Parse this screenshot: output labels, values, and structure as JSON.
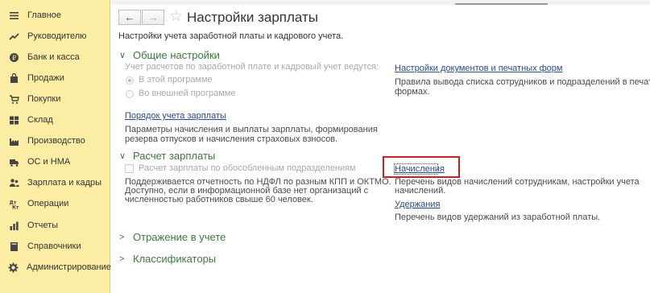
{
  "sidebar": {
    "items": [
      {
        "label": "Главное",
        "icon": "menu-icon"
      },
      {
        "label": "Руководителю",
        "icon": "trend-icon"
      },
      {
        "label": "Банк и касса",
        "icon": "coin-icon"
      },
      {
        "label": "Продажи",
        "icon": "bag-icon"
      },
      {
        "label": "Покупки",
        "icon": "cart-icon"
      },
      {
        "label": "Склад",
        "icon": "warehouse-icon"
      },
      {
        "label": "Производство",
        "icon": "factory-icon"
      },
      {
        "label": "ОС и НМА",
        "icon": "truck-icon"
      },
      {
        "label": "Зарплата и кадры",
        "icon": "people-icon"
      },
      {
        "label": "Операции",
        "icon": "dt-kt-icon"
      },
      {
        "label": "Отчеты",
        "icon": "chart-icon"
      },
      {
        "label": "Справочники",
        "icon": "book-icon"
      },
      {
        "label": "Администрирование",
        "icon": "gear-icon"
      }
    ]
  },
  "header": {
    "back": "←",
    "forward": "→",
    "title": "Настройки зарплаты",
    "subtitle": "Настройки учета заработной платы и кадрового учета."
  },
  "general": {
    "heading": "Общие настройки",
    "question": "Учет расчетов по заработной плате и кадровый учет ведутся:",
    "option_this": "В этой программе",
    "option_external": "Во внешней программе",
    "order_link": "Порядок учета зарплаты",
    "order_desc_1": "Параметры начисления и выплаты зарплаты, формирования",
    "order_desc_2": "резерва отпусков и начисления страховых взносов.",
    "docs_link": "Настройки документов и печатных форм",
    "docs_desc_1": "Правила вывода списка сотрудников и подразделений в печатных",
    "docs_desc_2": "формах."
  },
  "calc": {
    "heading": "Расчет зарплаты",
    "checkbox_label": "Расчет зарплаты по обособленным подразделениям",
    "note_1": "Поддерживается отчетность по НДФЛ по разным КПП и ОКТМО.",
    "note_2": "Доступно, если в информационной базе нет организаций с",
    "note_3": "численностью работников свыше 60 человек.",
    "accruals_link": "Начисления",
    "accruals_desc_1": "Перечень видов начислений сотрудникам, настройки учета",
    "accruals_desc_2": "начислений.",
    "deductions_link": "Удержания",
    "deductions_desc": "Перечень видов удержаний из заработной платы."
  },
  "collapsed": {
    "reflection": "Отражение в учете",
    "classifiers": "Классификаторы"
  },
  "colors": {
    "sidebar_bg": "#fbeda3",
    "section_green": "#3c7a3c",
    "link_blue": "#2a4a8a",
    "highlight_red": "#cc1f1f"
  }
}
